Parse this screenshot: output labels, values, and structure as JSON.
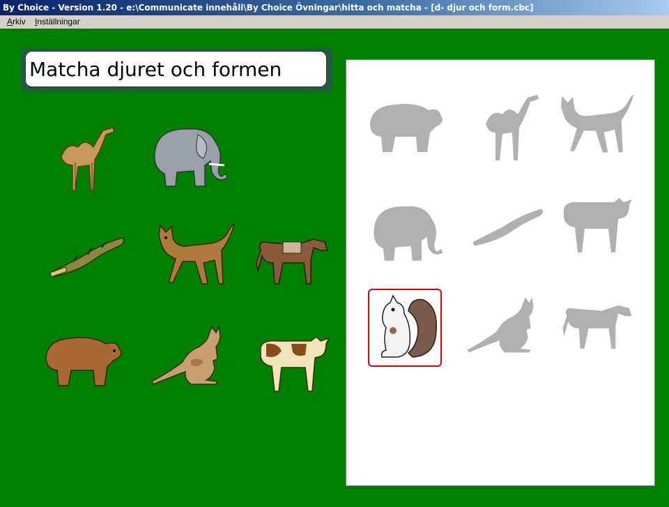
{
  "window": {
    "title": "By Choice - Version 1.20 - e:\\Communicate innehåll\\By Choice Övningar\\hitta och matcha - [d- djur och form.cbc]"
  },
  "menu": {
    "items": [
      "Arkiv",
      "Inställningar"
    ]
  },
  "exercise": {
    "title": "Matcha  djuret och formen"
  },
  "colors": {
    "background": "#008000",
    "silhouette": "#b0b0b0",
    "selection": "#e00000"
  },
  "animals": [
    "camel-icon",
    "elephant-icon",
    "crocodile-icon",
    "cat-icon",
    "horse-icon",
    "bear-icon",
    "kangaroo-icon",
    "cow-icon"
  ],
  "silhouettes": [
    "bear-silhouette",
    "camel-silhouette",
    "cat-silhouette",
    "elephant-silhouette",
    "crocodile-silhouette",
    "cow-silhouette",
    "squirrel-placed",
    "kangaroo-silhouette",
    "horse-silhouette"
  ]
}
